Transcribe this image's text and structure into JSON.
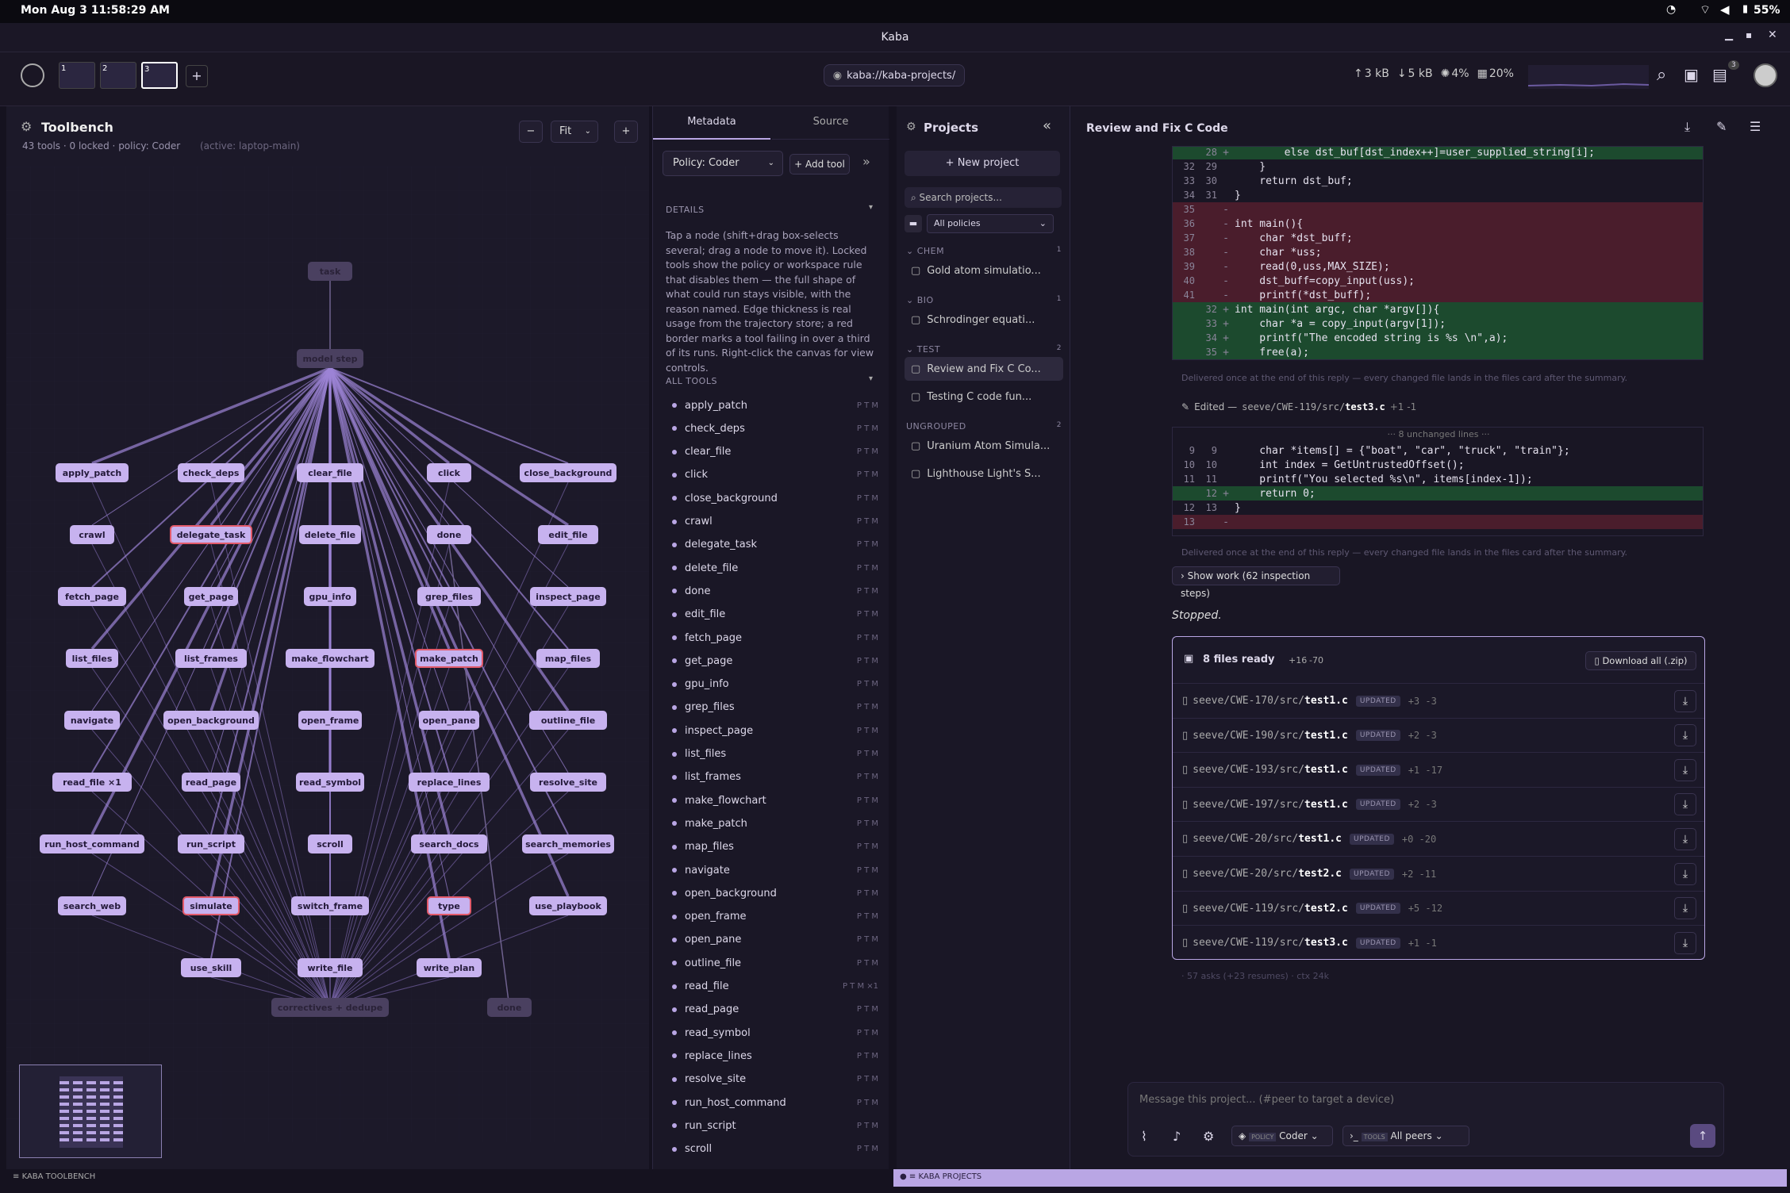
{
  "system": {
    "datetime": "Mon Aug 3  11:58:29 AM",
    "battery": "55%"
  },
  "window": {
    "title": "Kaba"
  },
  "appbar": {
    "url": "kaba://kaba-projects/",
    "net_up": "3 kB",
    "net_down": "5 kB",
    "cpu": "4%",
    "mem": "20%",
    "workspaces": [
      "1",
      "2",
      "3"
    ],
    "notif_count": "3"
  },
  "toolbench": {
    "title": "Toolbench",
    "subtitle": "43 tools · 0 locked · policy: Coder",
    "subtitle_active": "(active: laptop-main)",
    "zoom": "Fit",
    "zoom_minus": "−",
    "zoom_plus": "+",
    "footer": "KABA TOOLBENCH",
    "graph": {
      "task": "task",
      "model": "model step",
      "correctives": "correctives + dedupe",
      "done_end": "done",
      "nodes": [
        "apply_patch",
        "check_deps",
        "clear_file",
        "click",
        "close_background",
        "crawl",
        "delegate_task",
        "delete_file",
        "done",
        "edit_file",
        "fetch_page",
        "get_page",
        "gpu_info",
        "grep_files",
        "inspect_page",
        "list_files",
        "list_frames",
        "make_flowchart",
        "make_patch",
        "map_files",
        "navigate",
        "open_background",
        "open_frame",
        "open_pane",
        "outline_file",
        "read_file ×1",
        "read_page",
        "read_symbol",
        "replace_lines",
        "resolve_site",
        "run_host_command",
        "run_script",
        "scroll",
        "search_docs",
        "search_memories",
        "search_web",
        "simulate",
        "switch_frame",
        "type",
        "use_playbook",
        "use_skill",
        "write_file",
        "write_plan"
      ]
    }
  },
  "metadata": {
    "tabs": [
      "Metadata",
      "Source"
    ],
    "policy": "Policy: Coder",
    "add_tool": "+ Add tool",
    "details_label": "DETAILS",
    "details_text": "Tap a node (shift+drag box-selects several; drag a node to move it). Locked tools show the policy or workspace rule that disables them — the full shape of what could run stays visible, with the reason named. Edge thickness is real usage from the trajectory store; a red border marks a tool failing in over a third of its runs. Right-click the canvas for view controls.",
    "all_tools_label": "ALL TOOLS",
    "tools": [
      {
        "n": "apply_patch",
        "f": "P T M"
      },
      {
        "n": "check_deps",
        "f": "P T M"
      },
      {
        "n": "clear_file",
        "f": "P T M"
      },
      {
        "n": "click",
        "f": "P T M"
      },
      {
        "n": "close_background",
        "f": "P T M"
      },
      {
        "n": "crawl",
        "f": "P T M"
      },
      {
        "n": "delegate_task",
        "f": "P T M"
      },
      {
        "n": "delete_file",
        "f": "P T M"
      },
      {
        "n": "done",
        "f": "P T M"
      },
      {
        "n": "edit_file",
        "f": "P T M"
      },
      {
        "n": "fetch_page",
        "f": "P T M"
      },
      {
        "n": "get_page",
        "f": "P T M"
      },
      {
        "n": "gpu_info",
        "f": "P T M"
      },
      {
        "n": "grep_files",
        "f": "P T M"
      },
      {
        "n": "inspect_page",
        "f": "P T M"
      },
      {
        "n": "list_files",
        "f": "P T M"
      },
      {
        "n": "list_frames",
        "f": "P T M"
      },
      {
        "n": "make_flowchart",
        "f": "P T M"
      },
      {
        "n": "make_patch",
        "f": "P T M"
      },
      {
        "n": "map_files",
        "f": "P T M"
      },
      {
        "n": "navigate",
        "f": "P T M"
      },
      {
        "n": "open_background",
        "f": "P T M"
      },
      {
        "n": "open_frame",
        "f": "P T M"
      },
      {
        "n": "open_pane",
        "f": "P T M"
      },
      {
        "n": "outline_file",
        "f": "P T M"
      },
      {
        "n": "read_file",
        "f": "P T M ×1"
      },
      {
        "n": "read_page",
        "f": "P T M"
      },
      {
        "n": "read_symbol",
        "f": "P T M"
      },
      {
        "n": "replace_lines",
        "f": "P T M"
      },
      {
        "n": "resolve_site",
        "f": "P T M"
      },
      {
        "n": "run_host_command",
        "f": "P T M"
      },
      {
        "n": "run_script",
        "f": "P T M"
      },
      {
        "n": "scroll",
        "f": "P T M"
      }
    ]
  },
  "projects": {
    "title": "Projects",
    "new_project": "New project",
    "search_placeholder": "Search projects...",
    "filter": "All policies",
    "footer": "KABA PROJECTS",
    "groups": [
      {
        "name": "CHEM",
        "count": "1",
        "items": [
          "Gold atom simulatio..."
        ]
      },
      {
        "name": "BIO",
        "count": "1",
        "items": [
          "Schrodinger equati..."
        ]
      },
      {
        "name": "TEST",
        "count": "2",
        "items": [
          "Review and Fix C Co...",
          "Testing C code fun..."
        ]
      },
      {
        "name": "UNGROUPED",
        "count": "2",
        "items": [
          "Uranium Atom Simula...",
          "Lighthouse Light's S..."
        ]
      }
    ]
  },
  "chat": {
    "title": "Review and Fix C Code",
    "diff1": [
      {
        "a": "",
        "b": "28",
        "m": "+",
        "t": "        else dst_buf[dst_index++]=user_supplied_string[i];",
        "k": "add"
      },
      {
        "a": "32",
        "b": "29",
        "m": "",
        "t": "    }",
        "k": ""
      },
      {
        "a": "33",
        "b": "30",
        "m": "",
        "t": "    return dst_buf;",
        "k": ""
      },
      {
        "a": "34",
        "b": "31",
        "m": "",
        "t": "}",
        "k": ""
      },
      {
        "a": "35",
        "b": "",
        "m": "-",
        "t": "",
        "k": "del"
      },
      {
        "a": "36",
        "b": "",
        "m": "-",
        "t": "int main(){",
        "k": "del"
      },
      {
        "a": "37",
        "b": "",
        "m": "-",
        "t": "    char *dst_buff;",
        "k": "del"
      },
      {
        "a": "38",
        "b": "",
        "m": "-",
        "t": "    char *uss;",
        "k": "del"
      },
      {
        "a": "39",
        "b": "",
        "m": "-",
        "t": "    read(0,uss,MAX_SIZE);",
        "k": "del"
      },
      {
        "a": "40",
        "b": "",
        "m": "-",
        "t": "    dst_buff=copy_input(uss);",
        "k": "del"
      },
      {
        "a": "41",
        "b": "",
        "m": "-",
        "t": "    printf(*dst_buff);",
        "k": "del"
      },
      {
        "a": "",
        "b": "32",
        "m": "+",
        "t": "int main(int argc, char *argv[]){",
        "k": "add"
      },
      {
        "a": "",
        "b": "33",
        "m": "+",
        "t": "    char *a = copy_input(argv[1]);",
        "k": "add"
      },
      {
        "a": "",
        "b": "34",
        "m": "+",
        "t": "    printf(\"The encoded string is %s \\n\",a);",
        "k": "add"
      },
      {
        "a": "",
        "b": "35",
        "m": "+",
        "t": "    free(a);",
        "k": "add"
      }
    ],
    "note1": "Delivered once at the end of this reply — every changed file lands in the files card after the summary.",
    "edited_label": "Edited —",
    "edited_path": "seeve/CWE-119/src/",
    "edited_file": "test3.c",
    "edited_stat": "+1 -1",
    "unchanged": "··· 8 unchanged lines ···",
    "diff2": [
      {
        "a": "9",
        "b": "9",
        "m": "",
        "t": "    char *items[] = {\"boat\", \"car\", \"truck\", \"train\"};",
        "k": ""
      },
      {
        "a": "10",
        "b": "10",
        "m": "",
        "t": "    int index = GetUntrustedOffset();",
        "k": ""
      },
      {
        "a": "11",
        "b": "11",
        "m": "",
        "t": "    printf(\"You selected %s\\n\", items[index-1]);",
        "k": ""
      },
      {
        "a": "",
        "b": "12",
        "m": "+",
        "t": "    return 0;",
        "k": "add"
      },
      {
        "a": "12",
        "b": "13",
        "m": "",
        "t": "}",
        "k": ""
      },
      {
        "a": "13",
        "b": "",
        "m": "-",
        "t": "",
        "k": "del"
      }
    ],
    "note2": "Delivered once at the end of this reply — every changed file lands in the files card after the summary.",
    "show_work": "Show work (62 inspection steps)",
    "stopped": "Stopped.",
    "files_title": "8 files ready",
    "files_add": "+16",
    "files_del": "-70",
    "download_all": "Download all (.zip)",
    "files": [
      {
        "p": "seeve/CWE-170/src/",
        "f": "test1.c",
        "s": "+3 -3"
      },
      {
        "p": "seeve/CWE-190/src/",
        "f": "test1.c",
        "s": "+2 -3"
      },
      {
        "p": "seeve/CWE-193/src/",
        "f": "test1.c",
        "s": "+1 -17"
      },
      {
        "p": "seeve/CWE-197/src/",
        "f": "test1.c",
        "s": "+2 -3"
      },
      {
        "p": "seeve/CWE-20/src/",
        "f": "test1.c",
        "s": "+0 -20"
      },
      {
        "p": "seeve/CWE-20/src/",
        "f": "test2.c",
        "s": "+2 -11"
      },
      {
        "p": "seeve/CWE-119/src/",
        "f": "test2.c",
        "s": "+5 -12"
      },
      {
        "p": "seeve/CWE-119/src/",
        "f": "test3.c",
        "s": "+1 -1"
      }
    ],
    "updated": "UPDATED",
    "stats": "· 57 asks (+23 resumes) · ctx 24k",
    "input_placeholder": "Message this project... (#peer to target a device)",
    "policy_tag": "POLICY",
    "policy_val": "Coder",
    "tools_tag": "TOOLS",
    "tools_val": "All peers"
  }
}
